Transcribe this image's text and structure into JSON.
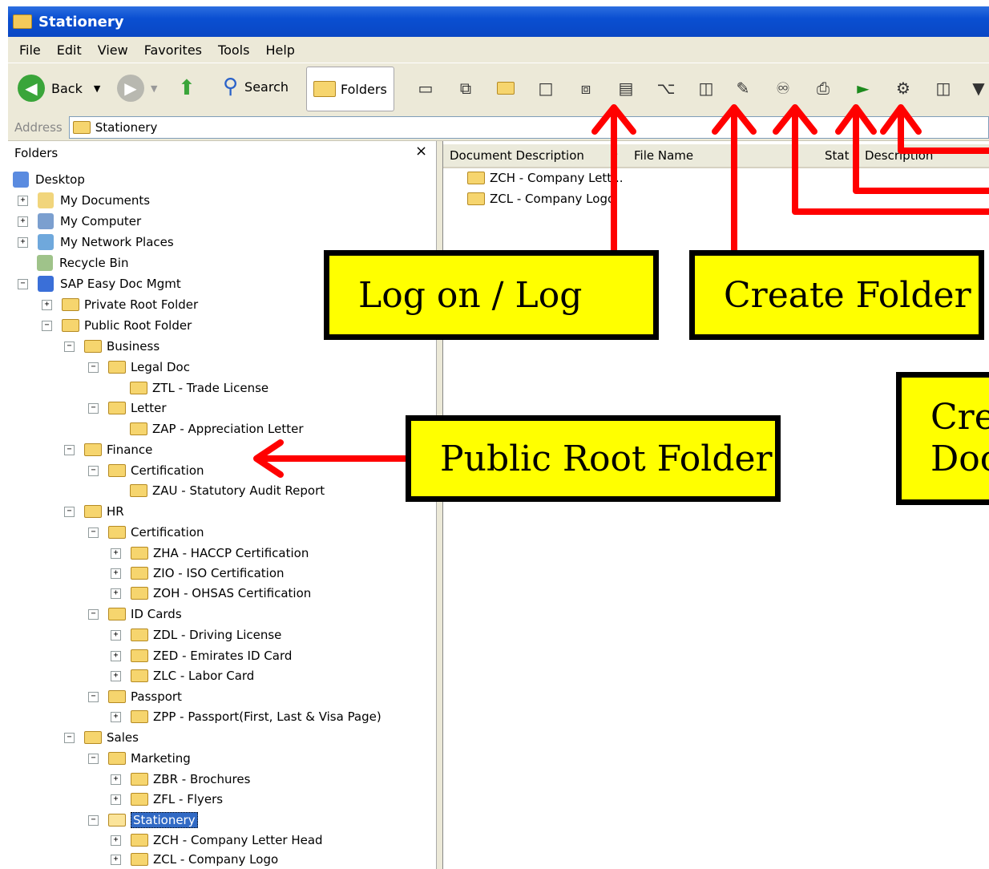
{
  "window": {
    "title": "Stationery"
  },
  "menu": [
    "File",
    "Edit",
    "View",
    "Favorites",
    "Tools",
    "Help"
  ],
  "toolbar": {
    "back_label": "Back",
    "search_label": "Search",
    "folders_label": "Folders"
  },
  "address": {
    "label": "Address",
    "value": "Stationery"
  },
  "folders_pane": {
    "title": "Folders",
    "close_glyph": "×"
  },
  "tree": {
    "desktop": "Desktop",
    "my_documents": "My Documents",
    "my_computer": "My Computer",
    "my_network": "My Network Places",
    "recycle_bin": "Recycle Bin",
    "sap": "SAP Easy Doc Mgmt",
    "private_root": "Private Root Folder",
    "public_root": "Public Root Folder",
    "business": "Business",
    "legal_doc": "Legal Doc",
    "ztl": "ZTL - Trade License",
    "letter": "Letter",
    "zap": "ZAP - Appreciation Letter",
    "finance": "Finance",
    "fin_cert": "Certification",
    "zau": "ZAU - Statutory Audit Report",
    "hr": "HR",
    "hr_cert": "Certification",
    "zha": "ZHA - HACCP Certification",
    "zio": "ZIO - ISO Certification",
    "zoh": "ZOH - OHSAS Certification",
    "id_cards": "ID Cards",
    "zdl": "ZDL - Driving License",
    "zed": "ZED - Emirates ID Card",
    "zlc": "ZLC - Labor Card",
    "passport": "Passport",
    "zpp": "ZPP - Passport(First, Last & Visa Page)",
    "sales": "Sales",
    "marketing": "Marketing",
    "zbr": "ZBR - Brochures",
    "zfl": "ZFL - Flyers",
    "stationery": "Stationery",
    "zch": "ZCH - Company Letter Head",
    "zcl": "ZCL - Company Logo"
  },
  "list": {
    "columns": [
      "Document Description",
      "File Name",
      "Stat",
      "Description"
    ],
    "rows": [
      "ZCH - Company Lett...",
      "ZCL - Company Logo"
    ]
  },
  "callouts": {
    "logon": "Log on / Log",
    "create_folder": "Create Folder",
    "public_root": "Public Root Folder",
    "create_doc_1": "Cre",
    "create_doc_2": "Doc"
  },
  "colors": {
    "callout_bg": "#ffff00",
    "arrow": "#ff0000",
    "title_bar": "#0a4fd1"
  }
}
